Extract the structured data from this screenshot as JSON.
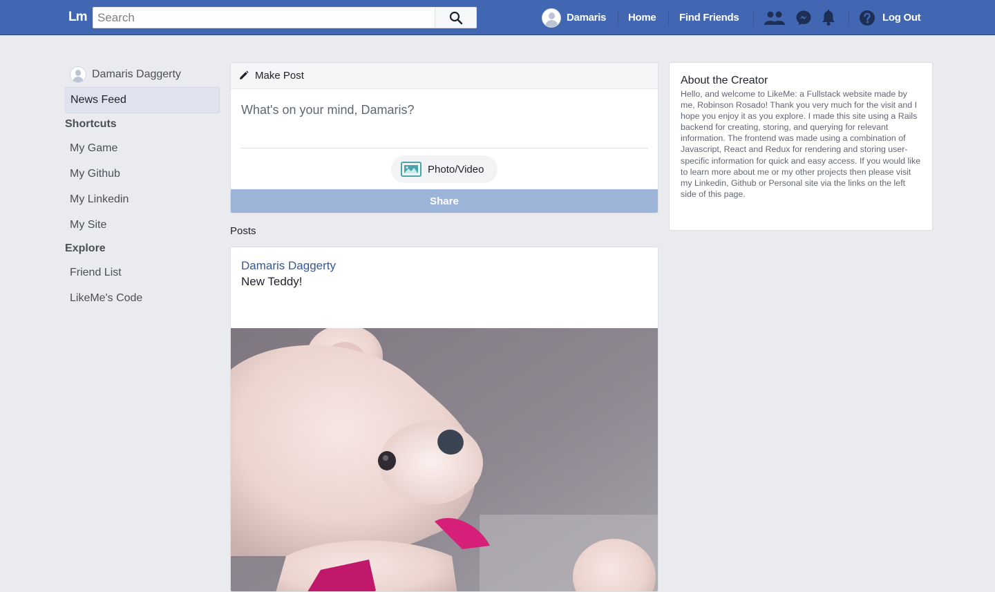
{
  "app": {
    "logo": "Lm"
  },
  "search": {
    "placeholder": "Search",
    "value": ""
  },
  "nav": {
    "user_name": "Damaris",
    "home": "Home",
    "find_friends": "Find Friends",
    "logout": "Log Out"
  },
  "sidebar": {
    "profile_name": "Damaris Daggerty",
    "active_item": "News Feed",
    "shortcuts_heading": "Shortcuts",
    "shortcuts": [
      {
        "label": "My Game"
      },
      {
        "label": "My Github"
      },
      {
        "label": "My Linkedin"
      },
      {
        "label": "My Site"
      }
    ],
    "explore_heading": "Explore",
    "explore": [
      {
        "label": "Friend List"
      },
      {
        "label": "LikeMe's Code"
      }
    ]
  },
  "composer": {
    "title": "Make Post",
    "placeholder": "What's on your mind, Damaris?",
    "photo_label": "Photo/Video",
    "share_label": "Share"
  },
  "posts": {
    "heading": "Posts",
    "items": [
      {
        "author": "Damaris Daggerty",
        "body": "New Teddy!"
      }
    ]
  },
  "about": {
    "title": "About the Creator",
    "text": "Hello, and welcome to LikeMe: a Fullstack website made by me, Robinson Rosado! Thank you very much for the visit and I hope you enjoy it as you explore. I made this site using a Rails backend for creating, storing, and querying for relevant information. The frontend was made using a combination of Javascript, React and Redux for rendering and storing user-specific information for quick and easy access. If you would like to learn more about me or my other projects then please visit my Linkedin, Github or Personal site via the links on the left side of this page."
  },
  "colors": {
    "brand": "#4267b2",
    "background": "#e9ebee",
    "share_button": "#9cb4d8",
    "author_link": "#365899"
  },
  "icons": [
    "search-icon",
    "friends-icon",
    "messenger-icon",
    "bell-icon",
    "help-icon",
    "pencil-icon",
    "photo-icon"
  ]
}
